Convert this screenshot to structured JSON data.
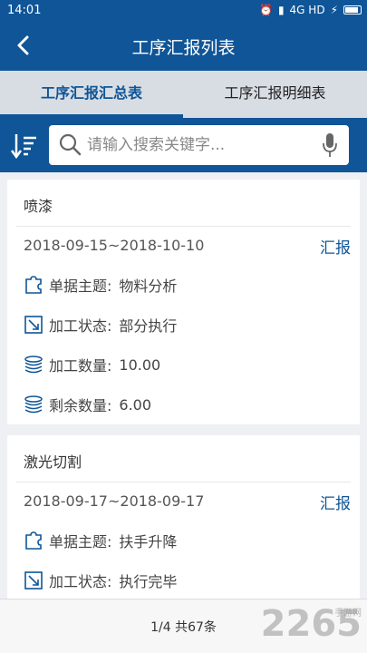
{
  "status_bar": {
    "time": "14:01",
    "network": "4G HD",
    "icons": [
      "alarm-icon",
      "mute-icon",
      "signal-icon",
      "charging-icon",
      "battery-icon"
    ]
  },
  "app_bar": {
    "title": "工序汇报列表",
    "back_icon": "back-arrow-icon"
  },
  "tabs": [
    {
      "label": "工序汇报汇总表",
      "active": true
    },
    {
      "label": "工序汇报明细表",
      "active": false
    }
  ],
  "search": {
    "placeholder": "请输入搜索关键字..."
  },
  "cards": [
    {
      "title": "喷漆",
      "date_range": "2018-09-15~2018-10-10",
      "action": "汇报",
      "fields": [
        {
          "label": "单据主题:",
          "value": "物料分析",
          "icon": "puzzle-icon"
        },
        {
          "label": "加工状态:",
          "value": "部分执行",
          "icon": "status-arrow-icon"
        },
        {
          "label": "加工数量:",
          "value": "10.00",
          "icon": "stack-icon"
        },
        {
          "label": "剩余数量:",
          "value": "6.00",
          "icon": "stack-icon"
        }
      ]
    },
    {
      "title": "激光切割",
      "date_range": "2018-09-17~2018-09-17",
      "action": "汇报",
      "fields": [
        {
          "label": "单据主题:",
          "value": "扶手升降",
          "icon": "puzzle-icon"
        },
        {
          "label": "加工状态:",
          "value": "执行完毕",
          "icon": "status-arrow-icon"
        }
      ]
    }
  ],
  "footer": {
    "pager": "1/4 共67条",
    "watermark": "2265",
    "watermark_sub": "手游网"
  },
  "colors": {
    "primary": "#0f5597",
    "tab_bg": "#d8dde3",
    "page_bg": "#eef0f3"
  }
}
